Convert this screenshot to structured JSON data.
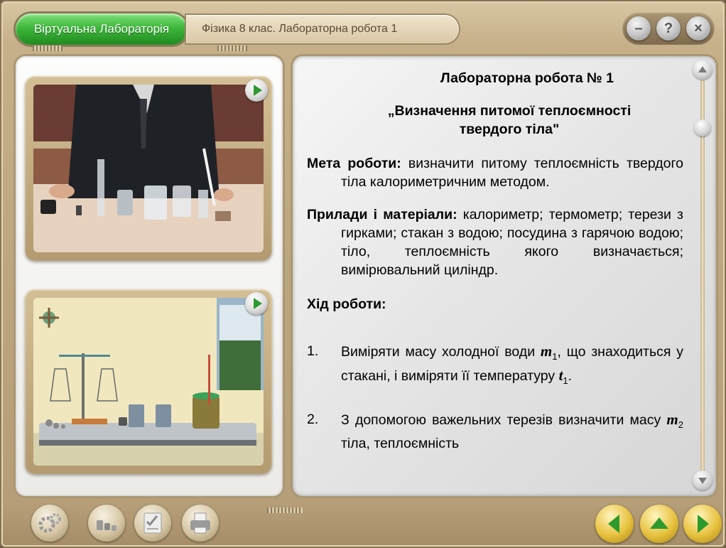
{
  "header": {
    "app_title": "Віртуальна Лабораторія",
    "subtitle": "Фізика 8 клас. Лабораторна робота 1"
  },
  "window_buttons": [
    {
      "name": "minimize-button",
      "glyph": "–"
    },
    {
      "name": "help-button",
      "glyph": "?"
    },
    {
      "name": "close-button",
      "glyph": "×"
    }
  ],
  "content": {
    "title": "Лабораторна робота № 1",
    "topic": "„Визначення питомої теплоємності твердого тіла\"",
    "goal_label": "Мета роботи:",
    "goal_text": "визначити питому теплоємність твердого тіла калориметричним методом.",
    "materials_label": "Прилади і матеріали:",
    "materials_text": "калориметр; термометр; терези з гирками; стакан з водою; посудина з гарячою водою; тіло, теплоємність якого визначається; вимірювальний циліндр.",
    "procedure_label": "Хід роботи:",
    "steps": [
      {
        "num": "1.",
        "t1": "Виміряти масу холодної води ",
        "v1": "m",
        "s1": "1",
        "t2": ", що знаходиться у стакані, і виміряти її температуру ",
        "v2": "t",
        "s2": "1",
        "t3": "."
      },
      {
        "num": "2.",
        "t1": "З допомогою важельних терезів визначити масу ",
        "v1": "m",
        "s1": "2",
        "t2": " тіла, теплоємність",
        "v2": "",
        "s2": "",
        "t3": ""
      }
    ]
  },
  "colors": {
    "accent_green": "#2e9a2e",
    "frame": "#bca67f",
    "nav_gold": "#e7c23e"
  },
  "toolbar": {
    "tools": [
      "settings-gears-icon",
      "weights-icon",
      "checklist-icon",
      "printer-icon"
    ],
    "nav": [
      "nav-back-button",
      "nav-up-button",
      "nav-forward-button"
    ]
  }
}
